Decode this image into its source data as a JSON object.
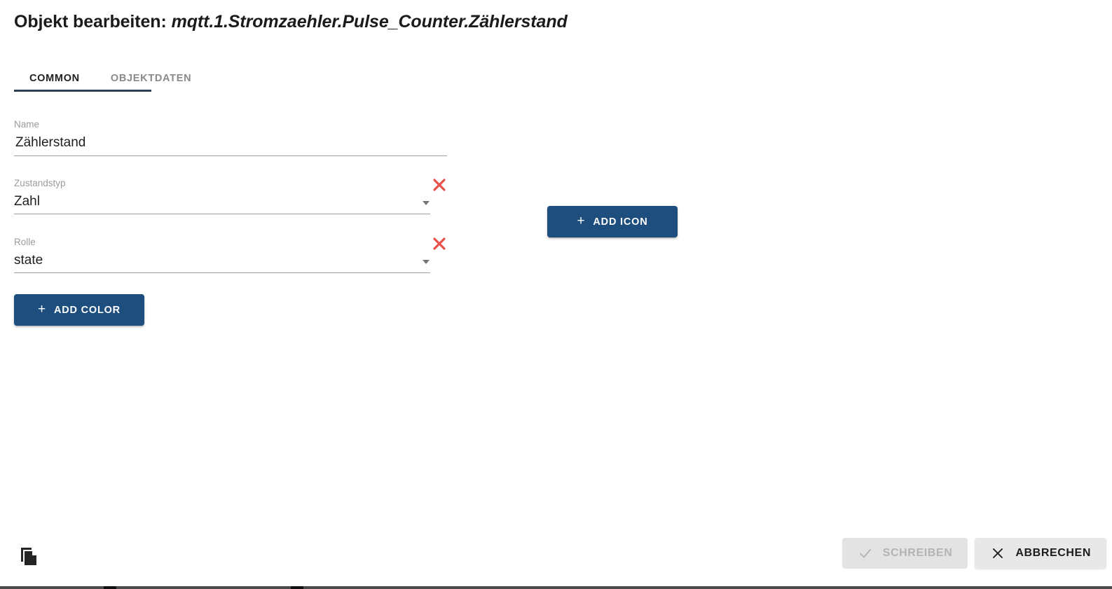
{
  "dialog": {
    "title_prefix": "Objekt bearbeiten:",
    "object_id": "mqtt.1.Stromzaehler.Pulse_Counter.Zählerstand"
  },
  "tabs": [
    {
      "label": "COMMON",
      "active": true
    },
    {
      "label": "OBJEKTDATEN",
      "active": false
    }
  ],
  "form": {
    "name": {
      "label": "Name",
      "value": "Zählerstand",
      "placeholder": ""
    },
    "state_type": {
      "label": "Zustandstyp",
      "value": "Zahl",
      "clear_title": "Löschen"
    },
    "role": {
      "label": "Rolle",
      "value": "state",
      "clear_title": "Löschen"
    }
  },
  "actions": {
    "add_color": "ADD COLOR",
    "add_icon": "ADD ICON",
    "plus": "+"
  },
  "footer": {
    "copy_title": "Kopieren",
    "write": "SCHREIBEN",
    "cancel": "ABBRECHEN"
  },
  "colors": {
    "primary": "#1d4e7e",
    "tab_indicator": "#2e4053",
    "clear_red": "#e8504a",
    "label_gray": "#9b9b9b",
    "disabled_bg": "#e3e3e3",
    "disabled_text": "#b3b3b3",
    "neutral_bg": "#e8e8e8"
  },
  "icons": {
    "clear": "close-x-icon",
    "caret": "chevron-down-icon",
    "copy": "copy-icon",
    "check": "check-icon",
    "cancel": "close-x-icon"
  }
}
